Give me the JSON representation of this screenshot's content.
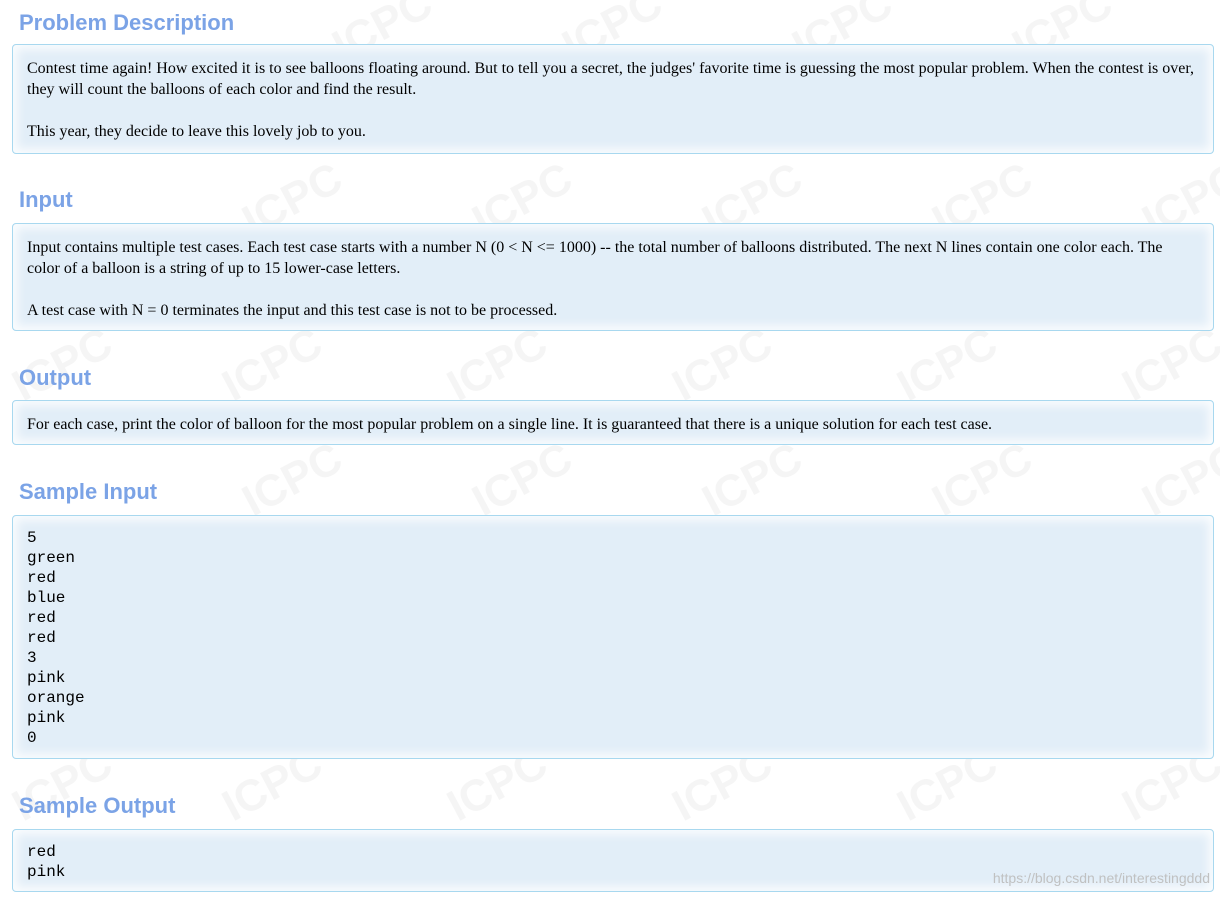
{
  "watermark": {
    "text": "ICPC"
  },
  "problem_description": {
    "title": "Problem Description",
    "paragraphs": [
      "Contest time again! How excited it is to see balloons floating around. But to tell you a secret, the judges' favorite time is guessing the most popular problem. When the contest is over, they will count the balloons of each color and find the result.",
      "This year, they decide to leave this lovely job to you."
    ]
  },
  "input": {
    "title": "Input",
    "paragraphs": [
      "Input contains multiple test cases. Each test case starts with a number N (0 < N <= 1000) -- the total number of balloons distributed. The next N lines contain one color each. The color of a balloon is a string of up to 15 lower-case letters.",
      "A test case with N = 0 terminates the input and this test case is not to be processed."
    ]
  },
  "output": {
    "title": "Output",
    "paragraphs": [
      "For each case, print the color of balloon for the most popular problem on a single line. It is guaranteed that there is a unique solution for each test case."
    ]
  },
  "sample_input": {
    "title": "Sample Input",
    "lines": [
      "5",
      "green",
      "red",
      "blue",
      "red",
      "red",
      "3",
      "pink",
      "orange",
      "pink",
      "0"
    ]
  },
  "sample_output": {
    "title": "Sample Output",
    "lines": [
      "red",
      "pink"
    ]
  },
  "footer": {
    "url_text": "https://blog.csdn.net/interestingddd"
  }
}
